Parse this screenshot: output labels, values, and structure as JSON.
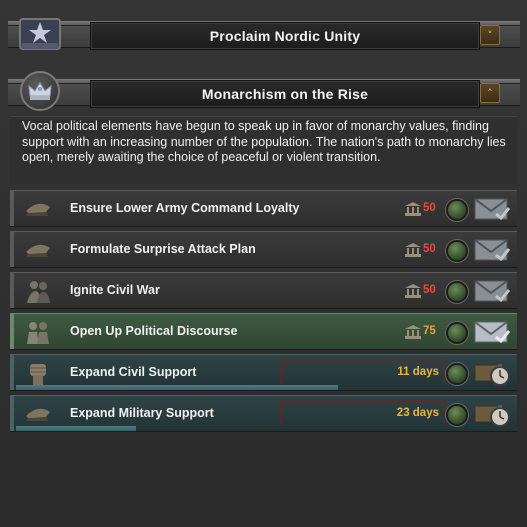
{
  "categories": [
    {
      "title": "Proclaim Nordic Unity",
      "icon": "nordic-unity-icon",
      "toggle": "˅"
    },
    {
      "title": "Monarchism on the Rise",
      "icon": "crown-icon",
      "toggle": "˄"
    }
  ],
  "description": "Vocal political elements have begun to speak up in favor of monarchy values, finding support with an increasing number of the population. The nation's path to monarchy lies open, merely awaiting the choice of peaceful or violent transition.",
  "decisions": [
    {
      "name": "Ensure Lower Army Command Loyalty",
      "icon": "officer-cap-icon",
      "cost": "50"
    },
    {
      "name": "Formulate Surprise Attack Plan",
      "icon": "officer-cap-icon",
      "cost": "50"
    },
    {
      "name": "Ignite Civil War",
      "icon": "crowd-icon",
      "cost": "50"
    },
    {
      "name": "Open Up Political Discourse",
      "icon": "people-icon",
      "cost": "75"
    },
    {
      "name": "Expand Civil Support",
      "icon": "fist-icon",
      "days": "11 days",
      "progress": 0.62
    },
    {
      "name": "Expand Military Support",
      "icon": "officer-cap-icon",
      "days": "23 days",
      "progress": 0.23
    }
  ],
  "colors": {
    "cost_red": "#e34c3c",
    "cost_orange": "#e8a33a",
    "days_gold": "#e7b73c",
    "active_green_row": "#3f5a42",
    "active_teal_row": "#2f4446",
    "progress": "#4b7f86"
  }
}
